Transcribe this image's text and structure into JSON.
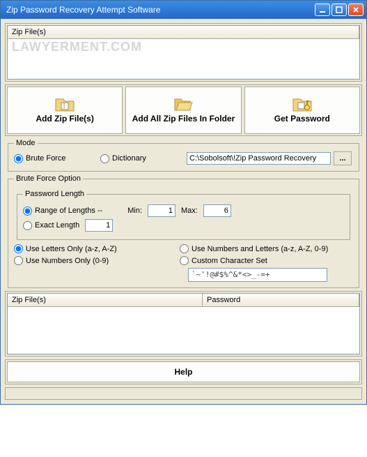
{
  "window": {
    "title": "Zip Password Recovery Attempt Software"
  },
  "watermark": "LAWYERMENT.COM",
  "filelist": {
    "header": "Zip File(s)"
  },
  "buttons": {
    "add_files": "Add Zip File(s)",
    "add_folder": "Add All Zip Files In Folder",
    "get_password": "Get Password",
    "browse": "...",
    "help": "Help"
  },
  "mode": {
    "legend": "Mode",
    "brute": "Brute Force",
    "dict": "Dictionary",
    "path": "C:\\Sobolsoft\\!Zip Password Recovery"
  },
  "bfo": {
    "legend": "Brute Force Option",
    "pwdlen": {
      "legend": "Password Length",
      "range": "Range of Lengths --",
      "minlabel": "Min:",
      "min": "1",
      "maxlabel": "Max:",
      "max": "6",
      "exact": "Exact Length",
      "exactval": "1"
    },
    "charset": {
      "letters": "Use Letters Only (a-z, A-Z)",
      "numbers": "Use Numbers Only (0-9)",
      "numletters": "Use Numbers and Letters (a-z, A-Z, 0-9)",
      "custom": "Custom Character Set",
      "customval": "`~'!@#$%^&*<>_-=+"
    }
  },
  "results": {
    "col1": "Zip File(s)",
    "col2": "Password"
  }
}
